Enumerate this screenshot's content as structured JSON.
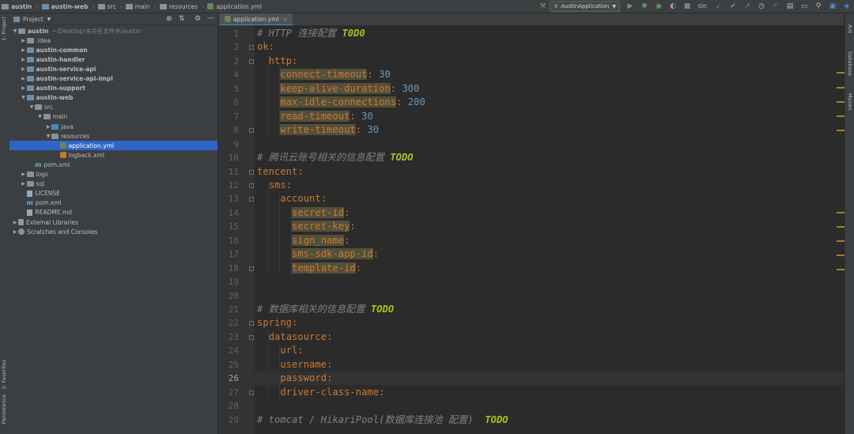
{
  "breadcrumbs": [
    {
      "label": "austin",
      "bold": true,
      "icon": "folder-icon"
    },
    {
      "label": "austin-web",
      "bold": true,
      "icon": "module-folder-icon"
    },
    {
      "label": "src",
      "icon": "folder-icon"
    },
    {
      "label": "main",
      "icon": "folder-icon"
    },
    {
      "label": "resources",
      "icon": "folder-icon"
    },
    {
      "label": "application.yml",
      "icon": "yaml-file-icon"
    }
  ],
  "toolbar": {
    "run_config": "AustinApplication",
    "git_label": "Git:"
  },
  "project_panel": {
    "title": "Project"
  },
  "tree": [
    {
      "depth": 0,
      "arrow": "down",
      "icon": "folder",
      "label": "austin",
      "bold": true,
      "hint": "~/Desktop/未命名文件夹/austin"
    },
    {
      "depth": 1,
      "arrow": "right",
      "icon": "folder",
      "label": ".idea"
    },
    {
      "depth": 1,
      "arrow": "right",
      "icon": "module",
      "label": "austin-common",
      "bold": true
    },
    {
      "depth": 1,
      "arrow": "right",
      "icon": "module",
      "label": "austin-handler",
      "bold": true
    },
    {
      "depth": 1,
      "arrow": "right",
      "icon": "module",
      "label": "austin-service-api",
      "bold": true
    },
    {
      "depth": 1,
      "arrow": "right",
      "icon": "module",
      "label": "austin-service-api-impl",
      "bold": true
    },
    {
      "depth": 1,
      "arrow": "right",
      "icon": "module",
      "label": "austin-support",
      "bold": true
    },
    {
      "depth": 1,
      "arrow": "down",
      "icon": "module",
      "label": "austin-web",
      "bold": true
    },
    {
      "depth": 2,
      "arrow": "down",
      "icon": "folder",
      "label": "src"
    },
    {
      "depth": 3,
      "arrow": "down",
      "icon": "folder",
      "label": "main"
    },
    {
      "depth": 4,
      "arrow": "right",
      "icon": "source",
      "label": "java"
    },
    {
      "depth": 4,
      "arrow": "down",
      "icon": "folder",
      "label": "resources"
    },
    {
      "depth": 5,
      "arrow": "",
      "icon": "yml",
      "label": "application.yml",
      "selected": true
    },
    {
      "depth": 5,
      "arrow": "",
      "icon": "xml",
      "label": "logback.xml"
    },
    {
      "depth": 2,
      "arrow": "",
      "icon": "maven",
      "label": "pom.xml"
    },
    {
      "depth": 1,
      "arrow": "right",
      "icon": "folder",
      "label": "logs"
    },
    {
      "depth": 1,
      "arrow": "right",
      "icon": "folder",
      "label": "sql"
    },
    {
      "depth": 1,
      "arrow": "",
      "icon": "file",
      "label": "LICENSE"
    },
    {
      "depth": 1,
      "arrow": "",
      "icon": "maven",
      "label": "pom.xml"
    },
    {
      "depth": 1,
      "arrow": "",
      "icon": "file",
      "label": "README.md"
    },
    {
      "depth": 0,
      "arrow": "right",
      "icon": "library",
      "label": "External Libraries"
    },
    {
      "depth": 0,
      "arrow": "right",
      "icon": "scratch",
      "label": "Scratches and Consoles"
    }
  ],
  "left_tool_tabs": {
    "project": "1: Project",
    "favorites": "2: Favorites",
    "persistence": "Persistence"
  },
  "right_tool_tabs": {
    "ant": "Ant",
    "database": "Database",
    "maven": "Maven"
  },
  "editor": {
    "tab_label": "application.yml",
    "current_line": 26,
    "lines": [
      {
        "n": 1,
        "tokens": [
          [
            "cmt",
            "# HTTP 连接配置 "
          ],
          [
            "todo",
            "T0D0"
          ]
        ]
      },
      {
        "n": 2,
        "tokens": [
          [
            "key",
            "ok"
          ],
          [
            "pun",
            ":"
          ]
        ]
      },
      {
        "n": 3,
        "tokens": [
          [
            "txt",
            "  "
          ],
          [
            "key",
            "http"
          ],
          [
            "pun",
            ":"
          ]
        ]
      },
      {
        "n": 4,
        "tokens": [
          [
            "txt",
            "    "
          ],
          [
            "hl",
            "connect-timeout"
          ],
          [
            "pun",
            ":"
          ],
          [
            "txt",
            " "
          ],
          [
            "num",
            "30"
          ]
        ]
      },
      {
        "n": 5,
        "tokens": [
          [
            "txt",
            "    "
          ],
          [
            "hl",
            "keep-alive-duration"
          ],
          [
            "pun",
            ":"
          ],
          [
            "txt",
            " "
          ],
          [
            "num",
            "300"
          ]
        ]
      },
      {
        "n": 6,
        "tokens": [
          [
            "txt",
            "    "
          ],
          [
            "hl",
            "max-idle-connections"
          ],
          [
            "pun",
            ":"
          ],
          [
            "txt",
            " "
          ],
          [
            "num",
            "200"
          ]
        ]
      },
      {
        "n": 7,
        "tokens": [
          [
            "txt",
            "    "
          ],
          [
            "hl",
            "read-timeout"
          ],
          [
            "pun",
            ":"
          ],
          [
            "txt",
            " "
          ],
          [
            "num",
            "30"
          ]
        ]
      },
      {
        "n": 8,
        "tokens": [
          [
            "txt",
            "    "
          ],
          [
            "hl",
            "write-timeout"
          ],
          [
            "pun",
            ":"
          ],
          [
            "txt",
            " "
          ],
          [
            "num",
            "30"
          ]
        ]
      },
      {
        "n": 9,
        "tokens": []
      },
      {
        "n": 10,
        "tokens": [
          [
            "cmt",
            "# 腾讯云账号相关的信息配置 "
          ],
          [
            "todo",
            "TODO"
          ]
        ]
      },
      {
        "n": 11,
        "tokens": [
          [
            "key",
            "tencent"
          ],
          [
            "pun",
            ":"
          ]
        ]
      },
      {
        "n": 12,
        "tokens": [
          [
            "txt",
            "  "
          ],
          [
            "key",
            "sms"
          ],
          [
            "pun",
            ":"
          ]
        ]
      },
      {
        "n": 13,
        "tokens": [
          [
            "txt",
            "    "
          ],
          [
            "key",
            "account"
          ],
          [
            "pun",
            ":"
          ]
        ]
      },
      {
        "n": 14,
        "tokens": [
          [
            "txt",
            "      "
          ],
          [
            "hl",
            "secret-id"
          ],
          [
            "pun",
            ":"
          ]
        ]
      },
      {
        "n": 15,
        "tokens": [
          [
            "txt",
            "      "
          ],
          [
            "hl",
            "secret-key"
          ],
          [
            "pun",
            ":"
          ]
        ]
      },
      {
        "n": 16,
        "tokens": [
          [
            "txt",
            "      "
          ],
          [
            "hl",
            "sign_name"
          ],
          [
            "pun",
            ":"
          ]
        ]
      },
      {
        "n": 17,
        "tokens": [
          [
            "txt",
            "      "
          ],
          [
            "hl",
            "sms-sdk-app-id"
          ],
          [
            "pun",
            ":"
          ]
        ]
      },
      {
        "n": 18,
        "tokens": [
          [
            "txt",
            "      "
          ],
          [
            "hl",
            "template-id"
          ],
          [
            "pun",
            ":"
          ]
        ]
      },
      {
        "n": 19,
        "tokens": []
      },
      {
        "n": 20,
        "tokens": []
      },
      {
        "n": 21,
        "tokens": [
          [
            "cmt",
            "# 数据库相关的信息配置 "
          ],
          [
            "todo",
            "TODO"
          ]
        ]
      },
      {
        "n": 22,
        "tokens": [
          [
            "key",
            "spring"
          ],
          [
            "pun",
            ":"
          ]
        ]
      },
      {
        "n": 23,
        "tokens": [
          [
            "txt",
            "  "
          ],
          [
            "key",
            "datasource"
          ],
          [
            "pun",
            ":"
          ]
        ]
      },
      {
        "n": 24,
        "tokens": [
          [
            "txt",
            "    "
          ],
          [
            "key",
            "url"
          ],
          [
            "pun",
            ":"
          ]
        ]
      },
      {
        "n": 25,
        "tokens": [
          [
            "txt",
            "    "
          ],
          [
            "key",
            "username"
          ],
          [
            "pun",
            ":"
          ]
        ]
      },
      {
        "n": 26,
        "tokens": [
          [
            "txt",
            "    "
          ],
          [
            "key",
            "password"
          ],
          [
            "pun",
            ":"
          ]
        ]
      },
      {
        "n": 27,
        "tokens": [
          [
            "txt",
            "    "
          ],
          [
            "key",
            "driver-class-name"
          ],
          [
            "pun",
            ":"
          ]
        ]
      },
      {
        "n": 28,
        "tokens": []
      },
      {
        "n": 29,
        "tokens": [
          [
            "cmt",
            "# tomcat / HikariPool(数据库连接池 配置)  "
          ],
          [
            "todo",
            "TODO"
          ]
        ]
      }
    ]
  },
  "colors": {
    "comment": "#808080",
    "todo": "#a8c023",
    "key": "#cc7832",
    "number": "#6897bb",
    "selection": "#2f65ca"
  }
}
